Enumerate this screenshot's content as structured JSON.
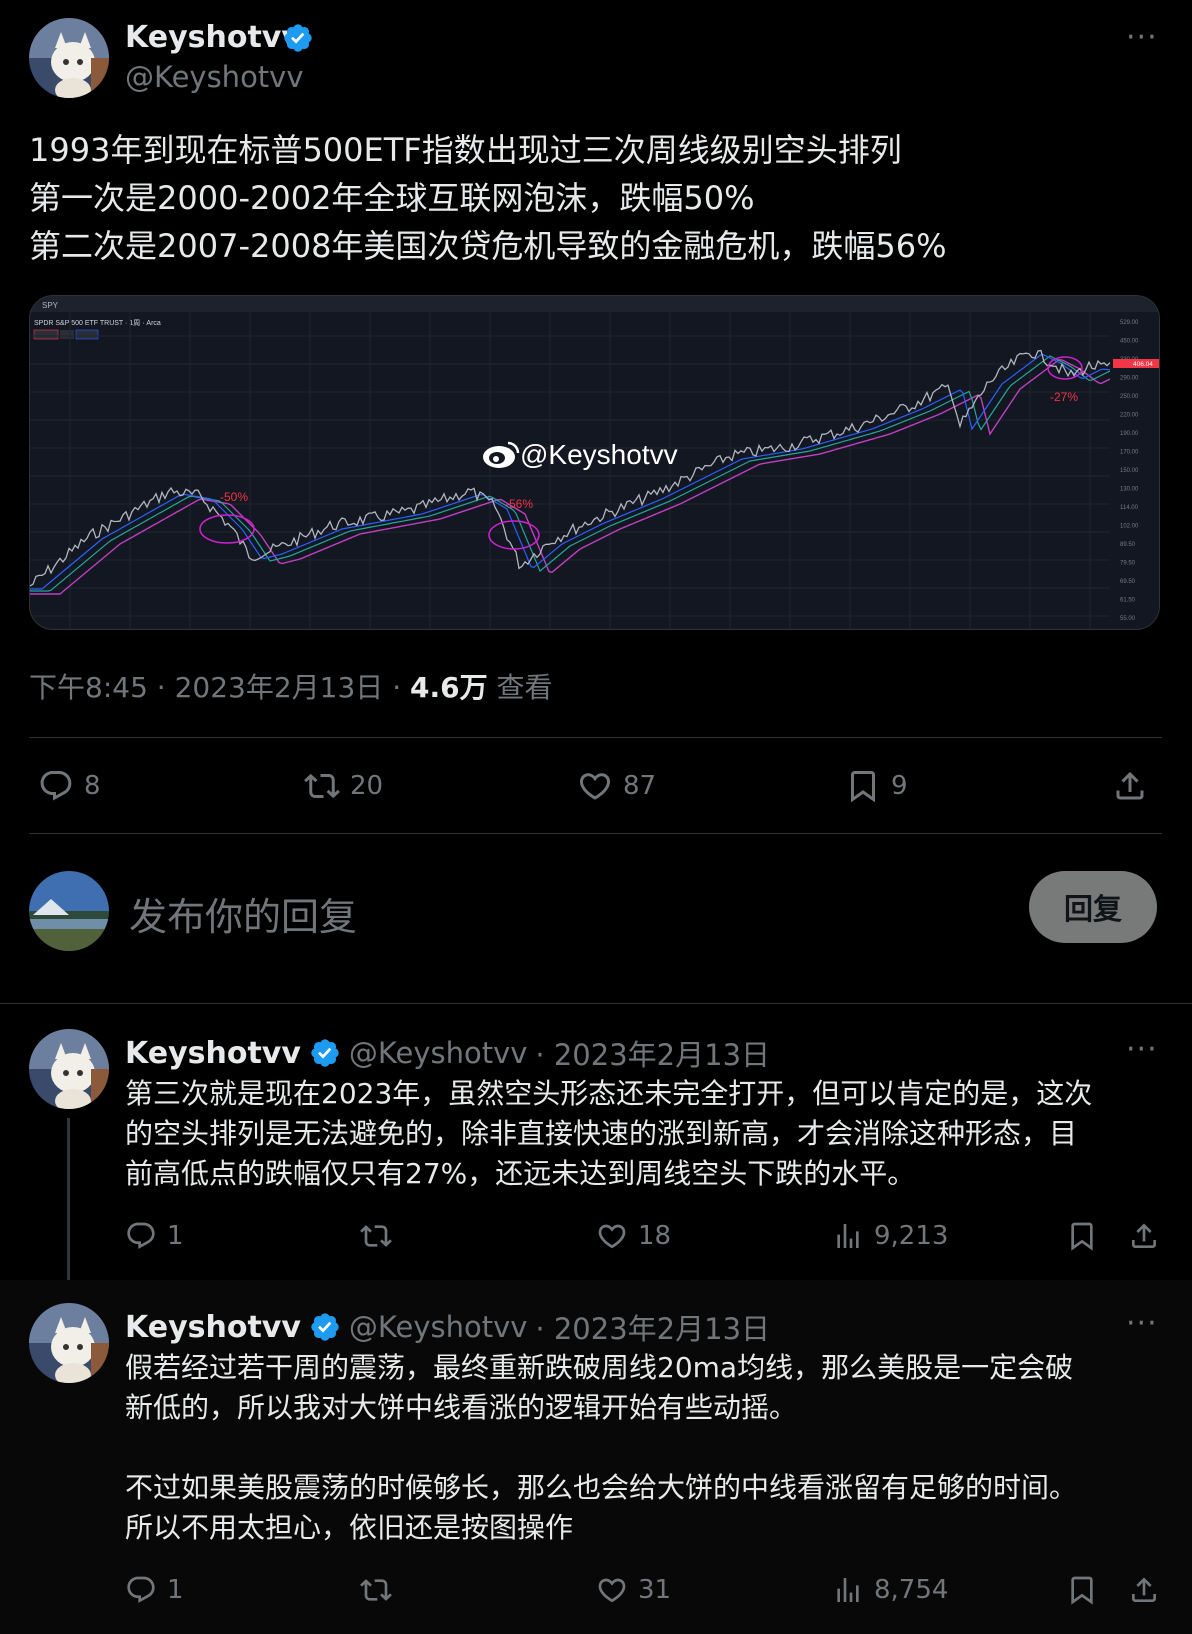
{
  "main_tweet": {
    "author_name": "Keyshotvv",
    "author_handle": "@Keyshotvv",
    "text": "1993年到现在标普500ETF指数出现过三次周线级别空头排列\n第一次是2000-2002年全球互联网泡沫，跌幅50%\n第二次是2007-2008年美国次贷危机导致的金融危机，跌幅56%",
    "more": "···",
    "time": "下午8:45",
    "date": "2023年2月13日",
    "sep": "·",
    "views_count": "4.6万",
    "views_label": "查看",
    "actions": {
      "replies": "8",
      "retweets": "20",
      "likes": "87",
      "bookmarks": "9"
    },
    "chart_image": {
      "symbol": "SPY",
      "title": "SPDR S&P 500 ETF TRUST · 1周 · Arca",
      "watermark": "@Keyshotvv",
      "annotations": [
        "-50%",
        "-56%",
        "-27%"
      ],
      "price_tag": "406.04",
      "axis_labels": [
        "529.00",
        "450.00",
        "330.00",
        "290.00",
        "250.00",
        "220.00",
        "190.00",
        "170.00",
        "150.00",
        "130.00",
        "114.00",
        "102.00",
        "89.50",
        "79.50",
        "69.50",
        "61.50",
        "55.00"
      ]
    }
  },
  "compose": {
    "placeholder": "发布你的回复",
    "button": "回复"
  },
  "replies": [
    {
      "author_name": "Keyshotvv",
      "author_handle": "@Keyshotvv",
      "date": "· 2023年2月13日",
      "more": "···",
      "text": "第三次就是现在2023年，虽然空头形态还未完全打开，但可以肯定的是，这次\n的空头排列是无法避免的，除非直接快速的涨到新高，才会消除这种形态，目\n前高低点的跌幅仅只有27%，还远未达到周线空头下跌的水平。",
      "actions": {
        "replies": "1",
        "retweets": "",
        "likes": "18",
        "views": "9,213"
      }
    },
    {
      "author_name": "Keyshotvv",
      "author_handle": "@Keyshotvv",
      "date": "· 2023年2月13日",
      "more": "···",
      "text": "假若经过若干周的震荡，最终重新跌破周线20ma均线，那么美股是一定会破\n新低的，所以我对大饼中线看涨的逻辑开始有些动摇。\n\n不过如果美股震荡的时候够长，那么也会给大饼的中线看涨留有足够的时间。\n所以不用太担心，依旧还是按图操作",
      "actions": {
        "replies": "1",
        "retweets": "",
        "likes": "31",
        "views": "8,754"
      }
    }
  ],
  "colors": {
    "verified": "#1d9bf0",
    "chart_bg": "#131722",
    "ma_pink": "#c040c0",
    "annotation": "#f23645"
  },
  "icons": [
    "verified-badge-icon",
    "reply-icon",
    "retweet-icon",
    "like-icon",
    "bookmark-icon",
    "share-icon",
    "views-icon",
    "weibo-icon"
  ]
}
